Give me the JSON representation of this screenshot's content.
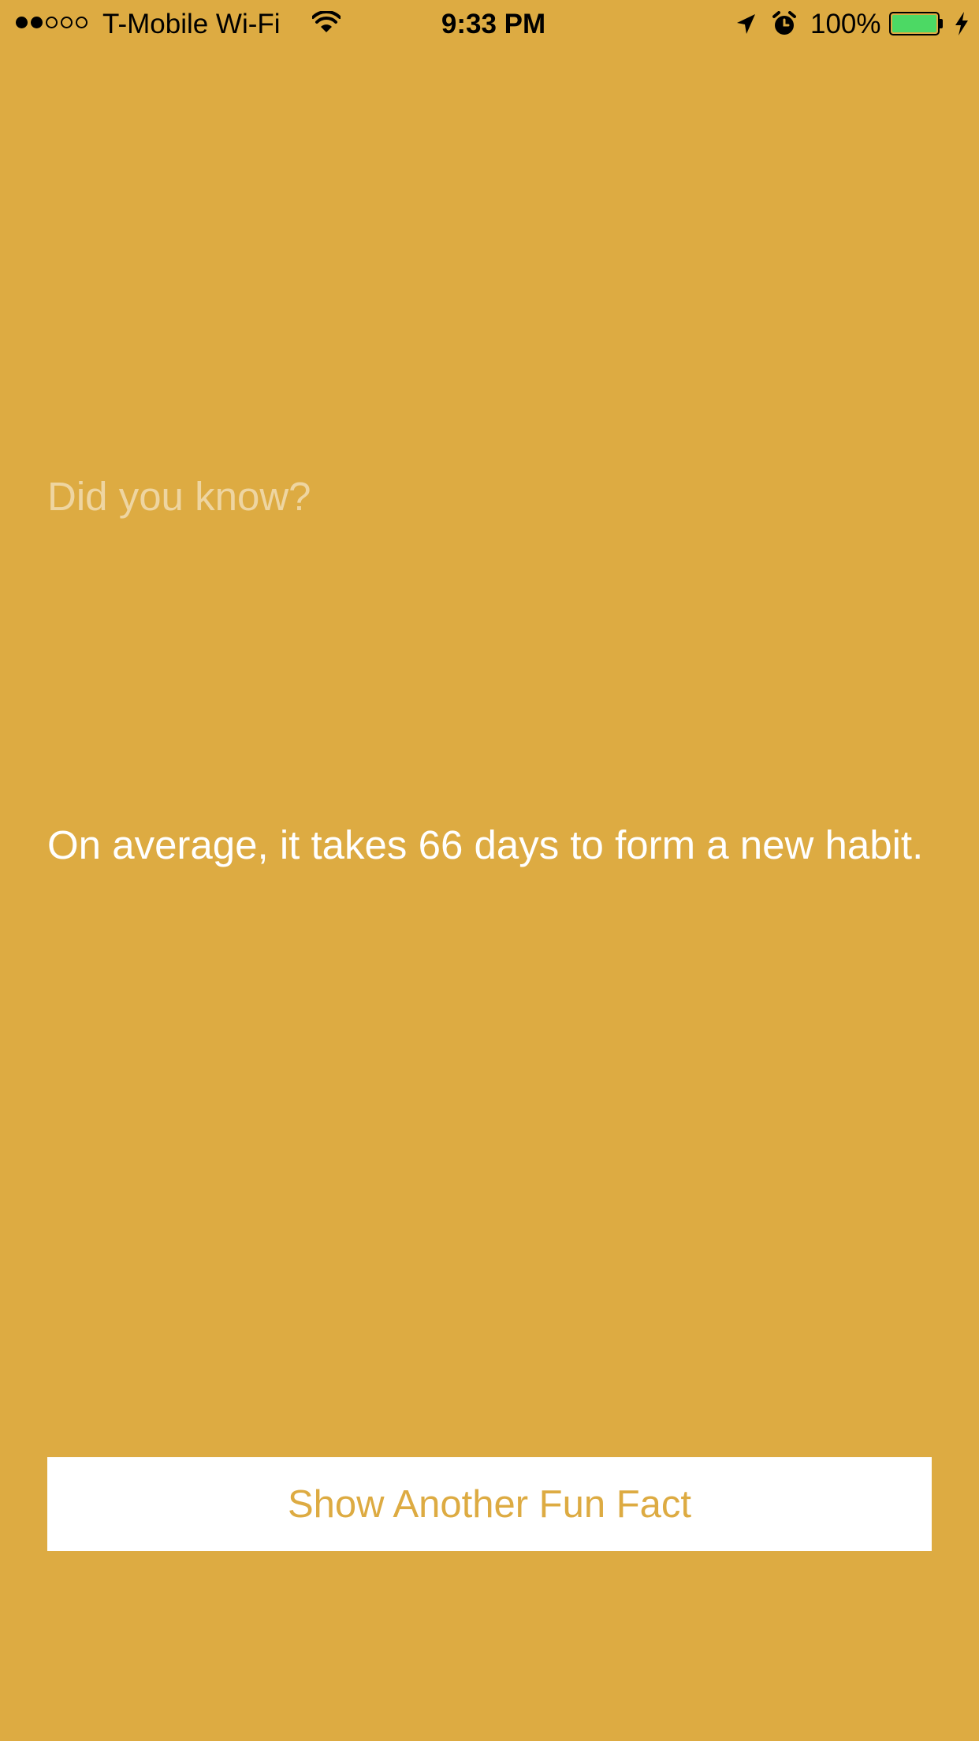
{
  "status_bar": {
    "signal_dots": [
      true,
      true,
      false,
      false,
      false
    ],
    "carrier": "T-Mobile Wi-Fi",
    "time": "9:33 PM",
    "battery_percent": "100%",
    "battery_level": 1.0,
    "battery_color": "#4CD964",
    "icons": [
      "wifi-icon",
      "location-arrow-icon",
      "alarm-icon",
      "battery-icon",
      "charging-bolt-icon"
    ]
  },
  "main": {
    "intro": "Did you know?",
    "fact": "On average, it takes 66 days to form a new habit.",
    "button_label": "Show Another Fun Fact"
  },
  "colors": {
    "background": "#DDAB42",
    "button_background": "#FFFFFF",
    "button_text": "#DDAB42",
    "fact_text": "#FFFFFF"
  }
}
